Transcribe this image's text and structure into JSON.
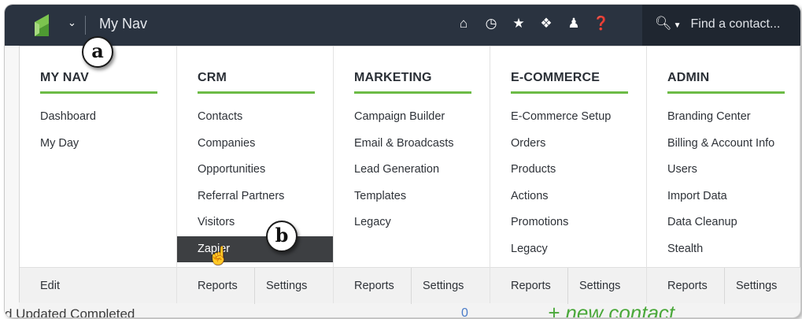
{
  "topbar": {
    "title": "My Nav",
    "icons": [
      "home-icon",
      "clock-icon",
      "star-icon",
      "puzzle-icon",
      "user-icon",
      "help-icon"
    ],
    "search": {
      "icon": "search-icon",
      "placeholder": "Find a contact..."
    }
  },
  "columns": [
    {
      "heading": "MY NAV",
      "items": [
        "Dashboard",
        "My Day"
      ],
      "footer": [
        "Edit"
      ]
    },
    {
      "heading": "CRM",
      "items": [
        "Contacts",
        "Companies",
        "Opportunities",
        "Referral Partners",
        "Visitors",
        "Zapier"
      ],
      "active": 5,
      "footer": [
        "Reports",
        "Settings"
      ]
    },
    {
      "heading": "MARKETING",
      "items": [
        "Campaign Builder",
        "Email & Broadcasts",
        "Lead Generation",
        "Templates",
        "Legacy"
      ],
      "footer": [
        "Reports",
        "Settings"
      ]
    },
    {
      "heading": "E-COMMERCE",
      "items": [
        "E-Commerce Setup",
        "Orders",
        "Products",
        "Actions",
        "Promotions",
        "Legacy"
      ],
      "footer": [
        "Reports",
        "Settings"
      ]
    },
    {
      "heading": "ADMIN",
      "items": [
        "Branding Center",
        "Billing & Account Info",
        "Users",
        "Import Data",
        "Data Cleanup",
        "Stealth"
      ],
      "footer": [
        "Reports",
        "Settings"
      ]
    }
  ],
  "background": {
    "bottom_left_text": "d Updated Completed",
    "bottom_number": "0",
    "bottom_right_text": "+ new contact"
  },
  "callouts": {
    "a": "a",
    "b": "b"
  },
  "colors": {
    "topbar": "#2a3340",
    "accent_green": "#6cbb46",
    "active_item": "#3d3f42"
  }
}
